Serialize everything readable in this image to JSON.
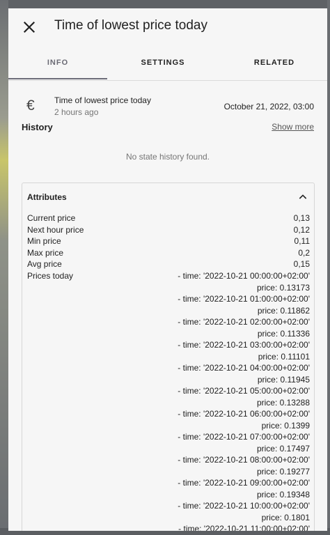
{
  "dialog": {
    "title": "Time of lowest price today",
    "close_icon": "close-icon"
  },
  "tabs": [
    {
      "label": "INFO",
      "active": true
    },
    {
      "label": "SETTINGS",
      "active": false
    },
    {
      "label": "RELATED",
      "active": false
    }
  ],
  "entity": {
    "icon": "euro-icon",
    "name": "Time of lowest price today",
    "last_changed": "2 hours ago",
    "state": "October 21, 2022, 03:00"
  },
  "history": {
    "title": "History",
    "show_more": "Show more",
    "empty_message": "No state history found."
  },
  "attributes": {
    "title": "Attributes",
    "expanded": true,
    "items": [
      {
        "key": "Current price",
        "value": "0,13"
      },
      {
        "key": "Next hour price",
        "value": "0,12"
      },
      {
        "key": "Min price",
        "value": "0,11"
      },
      {
        "key": "Max price",
        "value": "0,2"
      },
      {
        "key": "Avg price",
        "value": "0,15"
      }
    ],
    "prices_today_label": "Prices today",
    "prices_today": [
      {
        "time": "- time: '2022-10-21 00:00:00+02:00'",
        "price": "price: 0.13173"
      },
      {
        "time": "- time: '2022-10-21 01:00:00+02:00'",
        "price": "price: 0.11862"
      },
      {
        "time": "- time: '2022-10-21 02:00:00+02:00'",
        "price": "price: 0.11336"
      },
      {
        "time": "- time: '2022-10-21 03:00:00+02:00'",
        "price": "price: 0.11101"
      },
      {
        "time": "- time: '2022-10-21 04:00:00+02:00'",
        "price": "price: 0.11945"
      },
      {
        "time": "- time: '2022-10-21 05:00:00+02:00'",
        "price": "price: 0.13288"
      },
      {
        "time": "- time: '2022-10-21 06:00:00+02:00'",
        "price": "price: 0.1399"
      },
      {
        "time": "- time: '2022-10-21 07:00:00+02:00'",
        "price": "price: 0.17497"
      },
      {
        "time": "- time: '2022-10-21 08:00:00+02:00'",
        "price": "price: 0.19277"
      },
      {
        "time": "- time: '2022-10-21 09:00:00+02:00'",
        "price": "price: 0.19348"
      },
      {
        "time": "- time: '2022-10-21 10:00:00+02:00'",
        "price": "price: 0.1801"
      },
      {
        "time": "- time: '2022-10-21 11:00:00+02:00'",
        "price": ""
      }
    ]
  }
}
